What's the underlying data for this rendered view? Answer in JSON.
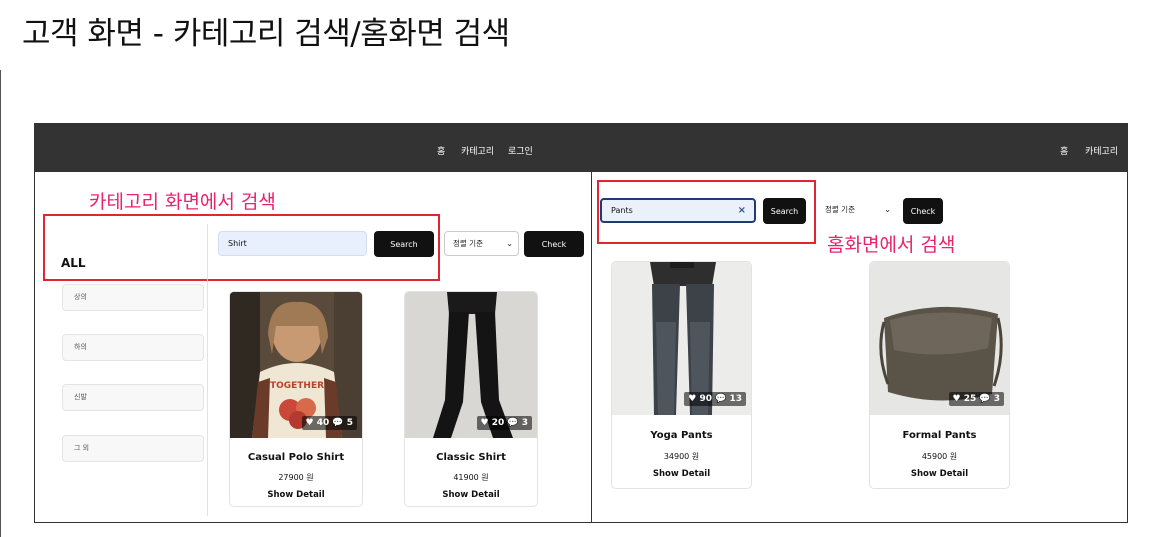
{
  "title": "고객 화면 - 카테고리 검색/홈화면 검색",
  "category_screen": {
    "nav": [
      "홈",
      "카테고리",
      "로그인"
    ],
    "annotation": "카테고리 화면에서 검색",
    "search": {
      "value": "Shirt",
      "button": "Search"
    },
    "sort": {
      "selected": "정렬 기준",
      "chevron": "⌄"
    },
    "check_button": "Check",
    "sidebar": {
      "all": "ALL",
      "items": [
        "상의",
        "하의",
        "신발",
        "그 외"
      ]
    },
    "products": [
      {
        "name": "Casual Polo Shirt",
        "price": "27900 원",
        "likes": 40,
        "comments": 5,
        "action": "Show Detail",
        "stats": "♥ 40 💬 5"
      },
      {
        "name": "Classic Shirt",
        "price": "41900 원",
        "likes": 20,
        "comments": 3,
        "action": "Show Detail",
        "stats": "♥ 20 💬 3"
      }
    ]
  },
  "home_screen": {
    "nav": [
      "홈",
      "카테고리"
    ],
    "annotation": "홈화면에서 검색",
    "search": {
      "value": "Pants",
      "clear": "×",
      "button": "Search"
    },
    "sort": {
      "selected": "정렬 기준",
      "chevron": "⌄"
    },
    "check_button": "Check",
    "products": [
      {
        "name": "Yoga Pants",
        "price": "34900 원",
        "likes": 90,
        "comments": 13,
        "action": "Show Detail",
        "stats": "♥ 90 💬 13"
      },
      {
        "name": "Formal Pants",
        "price": "45900 원",
        "likes": 25,
        "comments": 3,
        "action": "Show Detail",
        "stats": "♥ 25 💬 3"
      }
    ]
  },
  "colors": {
    "navbar": "#333333",
    "annotation": "#e8246e",
    "highlight_box": "#e0262f",
    "button": "#111111"
  },
  "icons": [
    "heart-icon",
    "comment-icon",
    "close-icon",
    "chevron-down-icon"
  ]
}
